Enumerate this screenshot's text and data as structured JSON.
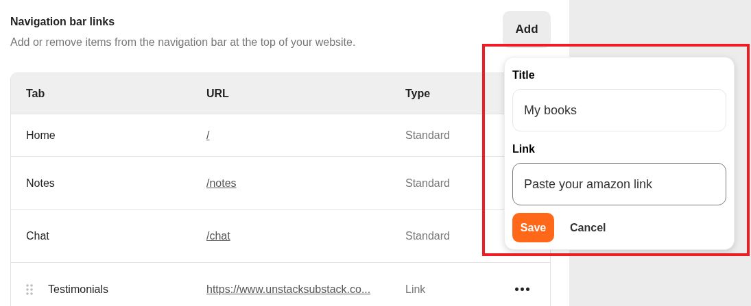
{
  "section": {
    "title": "Navigation bar links",
    "description": "Add or remove items from the navigation bar at the top of your website.",
    "add_button": "Add"
  },
  "table": {
    "columns": [
      "Tab",
      "URL",
      "Type"
    ],
    "rows": [
      {
        "tab": "Home",
        "url": "/",
        "type": "Standard",
        "hovered": false
      },
      {
        "tab": "Notes",
        "url": "/notes",
        "type": "Standard",
        "hovered": false
      },
      {
        "tab": "Chat",
        "url": "/chat",
        "type": "Standard",
        "hovered": false
      },
      {
        "tab": "Testimonials",
        "url": "https://www.unstacksubstack.co...",
        "type": "Link",
        "hovered": true
      }
    ]
  },
  "popover": {
    "highlighted": true,
    "fields": [
      {
        "label": "Title",
        "value": "My books",
        "focused": false
      },
      {
        "label": "Link",
        "placeholder": "Paste your amazon link",
        "focused": true
      }
    ],
    "save": "Save",
    "cancel": "Cancel"
  }
}
